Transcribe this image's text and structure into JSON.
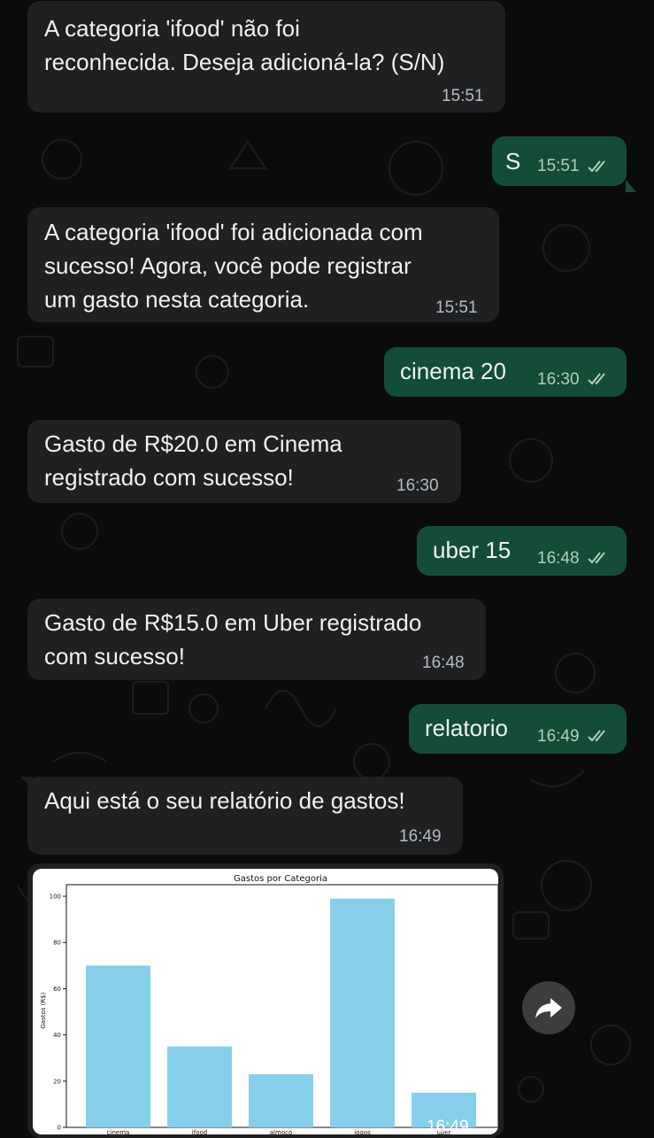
{
  "messages": [
    {
      "dir": "in",
      "text": "A categoria 'ifood' não foi\nreconhecida. Deseja adicioná-la? (S/N)",
      "time": "15:51"
    },
    {
      "dir": "out",
      "text": "S",
      "time": "15:51"
    },
    {
      "dir": "in",
      "text": "A categoria 'ifood' foi adicionada com\nsucesso! Agora, você pode registrar\num gasto nesta categoria.",
      "time": "15:51"
    },
    {
      "dir": "out",
      "text": "cinema 20",
      "time": "16:30"
    },
    {
      "dir": "in",
      "text": "Gasto de R$20.0 em Cinema\nregistrado com sucesso!",
      "time": "16:30"
    },
    {
      "dir": "out",
      "text": "uber 15",
      "time": "16:48"
    },
    {
      "dir": "in",
      "text": "Gasto de R$15.0 em Uber registrado\ncom sucesso!",
      "time": "16:48"
    },
    {
      "dir": "out",
      "text": "relatorio",
      "time": "16:49"
    },
    {
      "dir": "in",
      "text": "Aqui está o seu relatório de gastos!",
      "time": "16:49"
    }
  ],
  "image_message": {
    "time": "16:49",
    "forward_icon": "forward-arrow-icon"
  },
  "colors": {
    "background": "#0b0b0b",
    "incoming": "#1f2022",
    "outgoing": "#134d37",
    "bar": "#87ceeb",
    "read_ticks": "#b3cdbf"
  },
  "chart_data": {
    "type": "bar",
    "title": "Gastos por Categoria",
    "xlabel": "",
    "ylabel": "Gastos (R$)",
    "categories": [
      "cinema",
      "ifood",
      "almoco",
      "jogos",
      "uber"
    ],
    "values": [
      70,
      35,
      23,
      99,
      15
    ],
    "ylim": [
      0,
      105
    ],
    "yticks": [
      0,
      20,
      40,
      60,
      80,
      100
    ],
    "color": "#87ceeb"
  }
}
